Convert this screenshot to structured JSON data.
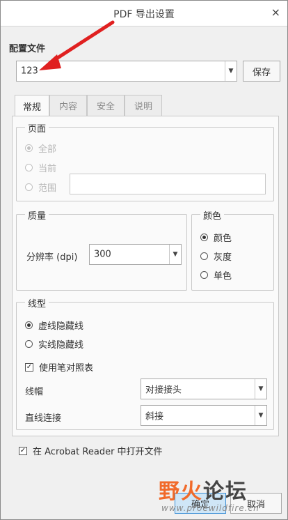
{
  "window": {
    "title": "PDF 导出设置",
    "close_symbol": "×"
  },
  "config": {
    "label": "配置文件",
    "value": "123",
    "save_button": "保存"
  },
  "tabs": [
    {
      "label": "常规",
      "active": true
    },
    {
      "label": "内容",
      "active": false
    },
    {
      "label": "安全",
      "active": false
    },
    {
      "label": "说明",
      "active": false
    }
  ],
  "pages": {
    "legend": "页面",
    "options": [
      {
        "label": "全部",
        "checked": true
      },
      {
        "label": "当前",
        "checked": false
      },
      {
        "label": "范围",
        "checked": false
      }
    ],
    "range_value": ""
  },
  "quality": {
    "legend": "质量",
    "resolution_label": "分辨率 (dpi)",
    "resolution_value": "300"
  },
  "color": {
    "legend": "颜色",
    "options": [
      {
        "label": "颜色",
        "checked": true
      },
      {
        "label": "灰度",
        "checked": false
      },
      {
        "label": "单色",
        "checked": false
      }
    ]
  },
  "linetype": {
    "legend": "线型",
    "options": [
      {
        "label": "虚线隐藏线",
        "checked": true
      },
      {
        "label": "实线隐藏线",
        "checked": false
      }
    ],
    "pen_table": {
      "label": "使用笔对照表",
      "checked": true
    },
    "cap_label": "线帽",
    "cap_value": "对接接头",
    "join_label": "直线连接",
    "join_value": "斜接"
  },
  "acrobat": {
    "label": "在 Acrobat Reader 中打开文件",
    "checked": true
  },
  "buttons": {
    "ok": "确定",
    "cancel": "取消"
  },
  "watermark": {
    "text_accent": "野火",
    "text_main": "论坛",
    "url": "www.proewildfire.cn"
  },
  "colors": {
    "annotation_arrow": "#e02020",
    "watermark_accent": "#f16a2a",
    "ok_button": "#cfe6f7"
  }
}
